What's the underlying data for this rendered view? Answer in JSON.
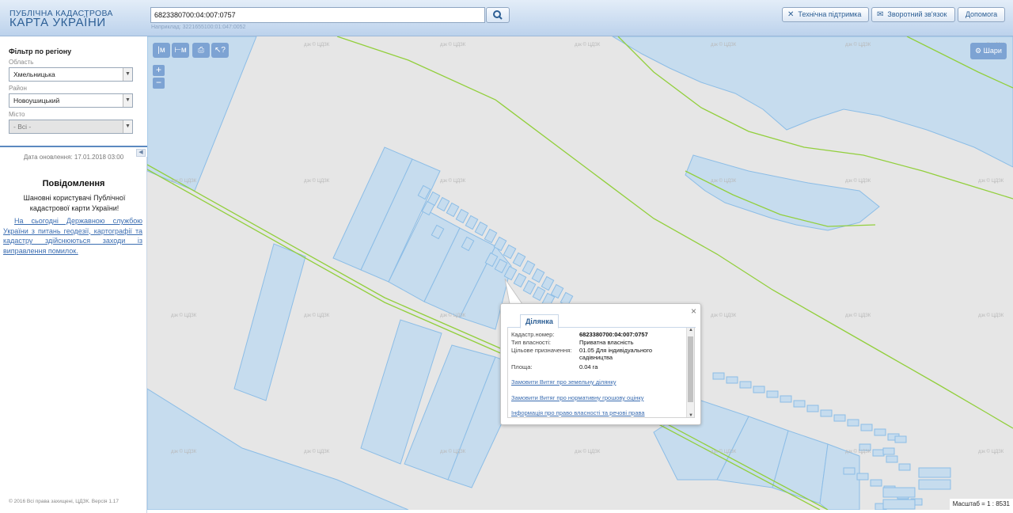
{
  "header": {
    "logo_line1": "ПУБЛІЧНА КАДАСТРОВА",
    "logo_line2": "КАРТА УКРАЇНИ",
    "search_value": "6823380700:04:007:0757",
    "search_example": "Наприклад: 3221655100:01:047:0052",
    "buttons": {
      "support": "Технічна підтримка",
      "feedback": "Зворотний зв'язок",
      "help": "Допомога"
    }
  },
  "sidebar": {
    "filter_title": "Фільтр по регіону",
    "region_label": "Область",
    "region_value": "Хмельницька",
    "district_label": "Район",
    "district_value": "Новоушицький",
    "city_label": "Місто",
    "city_value": "- Всі -",
    "updated": "Дата оновлення: 17.01.2018 03:00",
    "notice_title": "Повідомлення",
    "notice_body": "Шановні користувачі Публічної кадастрової карти України!",
    "notice_link": "На сьогодні Державною службою України з питань геодезії, картографії та кадастру здійснюються заходи із виправлення помилок.",
    "copyright": "© 2016 Всі права захищені, ЦДЗК. Версія 1.17"
  },
  "map": {
    "tools": [
      "|м",
      "⊢м",
      "⎙",
      "↖?"
    ],
    "zoom_in": "+",
    "zoom_out": "−",
    "layers_label": "Шари",
    "watermark": "дзк © ЦДЗК",
    "scale": "Масштаб = 1 : 8531"
  },
  "popup": {
    "tab": "Ділянка",
    "fields": [
      {
        "key": "Кадастр.номер:",
        "value": "6823380700:04:007:0757"
      },
      {
        "key": "Тип власності:",
        "value": "Приватна власність"
      },
      {
        "key": "Цільове призначення:",
        "value": "01.05 Для індивідуального садівництва"
      },
      {
        "key": "Площа:",
        "value": "0.04 га"
      }
    ],
    "links": [
      "Замовити Витяг про земельну ділянку",
      "Замовити Витяг про нормативну грошову оцінку",
      "Інформація про право власності та речові права"
    ]
  },
  "colors": {
    "parcel_fill": "#c6dcee",
    "parcel_stroke": "#8cbde6",
    "boundary": "#92cf3c",
    "map_bg": "#e6e6e6",
    "header_text": "#2d5f95"
  }
}
